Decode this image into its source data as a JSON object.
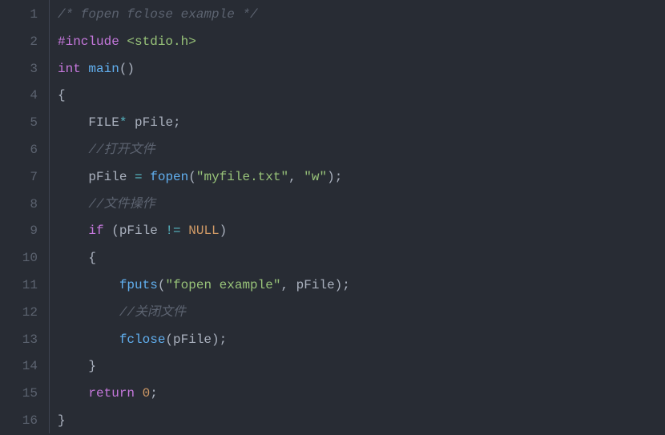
{
  "editor": {
    "lines": [
      {
        "n": "1",
        "tokens": [
          {
            "cls": "tok-comment",
            "t": "/* fopen fclose example */"
          }
        ]
      },
      {
        "n": "2",
        "tokens": [
          {
            "cls": "tok-preproc",
            "t": "#include"
          },
          {
            "cls": "tok-punct",
            "t": " "
          },
          {
            "cls": "tok-include-path",
            "t": "<stdio.h>"
          }
        ]
      },
      {
        "n": "3",
        "tokens": [
          {
            "cls": "tok-type",
            "t": "int"
          },
          {
            "cls": "tok-punct",
            "t": " "
          },
          {
            "cls": "tok-func",
            "t": "main"
          },
          {
            "cls": "tok-punct",
            "t": "()"
          }
        ]
      },
      {
        "n": "4",
        "tokens": [
          {
            "cls": "tok-punct",
            "t": "{"
          }
        ]
      },
      {
        "n": "5",
        "tokens": [
          {
            "cls": "tok-punct",
            "t": "    "
          },
          {
            "cls": "tok-ident",
            "t": "FILE"
          },
          {
            "cls": "tok-operator",
            "t": "*"
          },
          {
            "cls": "tok-punct",
            "t": " "
          },
          {
            "cls": "tok-ident",
            "t": "pFile"
          },
          {
            "cls": "tok-punct",
            "t": ";"
          }
        ]
      },
      {
        "n": "6",
        "tokens": [
          {
            "cls": "tok-punct",
            "t": "    "
          },
          {
            "cls": "tok-comment",
            "t": "//打开文件"
          }
        ]
      },
      {
        "n": "7",
        "tokens": [
          {
            "cls": "tok-punct",
            "t": "    "
          },
          {
            "cls": "tok-ident",
            "t": "pFile "
          },
          {
            "cls": "tok-operator",
            "t": "="
          },
          {
            "cls": "tok-punct",
            "t": " "
          },
          {
            "cls": "tok-func",
            "t": "fopen"
          },
          {
            "cls": "tok-punct",
            "t": "("
          },
          {
            "cls": "tok-string",
            "t": "\"myfile.txt\""
          },
          {
            "cls": "tok-punct",
            "t": ", "
          },
          {
            "cls": "tok-string",
            "t": "\"w\""
          },
          {
            "cls": "tok-punct",
            "t": ");"
          }
        ]
      },
      {
        "n": "8",
        "tokens": [
          {
            "cls": "tok-punct",
            "t": "    "
          },
          {
            "cls": "tok-comment",
            "t": "//文件操作"
          }
        ]
      },
      {
        "n": "9",
        "tokens": [
          {
            "cls": "tok-punct",
            "t": "    "
          },
          {
            "cls": "tok-keyword",
            "t": "if"
          },
          {
            "cls": "tok-punct",
            "t": " (pFile "
          },
          {
            "cls": "tok-operator",
            "t": "!="
          },
          {
            "cls": "tok-punct",
            "t": " "
          },
          {
            "cls": "tok-const",
            "t": "NULL"
          },
          {
            "cls": "tok-punct",
            "t": ")"
          }
        ]
      },
      {
        "n": "10",
        "tokens": [
          {
            "cls": "tok-punct",
            "t": "    {"
          }
        ]
      },
      {
        "n": "11",
        "tokens": [
          {
            "cls": "tok-punct",
            "t": "        "
          },
          {
            "cls": "tok-func",
            "t": "fputs"
          },
          {
            "cls": "tok-punct",
            "t": "("
          },
          {
            "cls": "tok-string",
            "t": "\"fopen example\""
          },
          {
            "cls": "tok-punct",
            "t": ", pFile);"
          }
        ]
      },
      {
        "n": "12",
        "tokens": [
          {
            "cls": "tok-punct",
            "t": "        "
          },
          {
            "cls": "tok-comment",
            "t": "//关闭文件"
          }
        ]
      },
      {
        "n": "13",
        "tokens": [
          {
            "cls": "tok-punct",
            "t": "        "
          },
          {
            "cls": "tok-func",
            "t": "fclose"
          },
          {
            "cls": "tok-punct",
            "t": "(pFile);"
          }
        ]
      },
      {
        "n": "14",
        "tokens": [
          {
            "cls": "tok-punct",
            "t": "    }"
          }
        ]
      },
      {
        "n": "15",
        "tokens": [
          {
            "cls": "tok-punct",
            "t": "    "
          },
          {
            "cls": "tok-keyword",
            "t": "return"
          },
          {
            "cls": "tok-punct",
            "t": " "
          },
          {
            "cls": "tok-number",
            "t": "0"
          },
          {
            "cls": "tok-punct",
            "t": ";"
          }
        ]
      },
      {
        "n": "16",
        "tokens": [
          {
            "cls": "tok-punct",
            "t": "}"
          }
        ]
      }
    ]
  }
}
